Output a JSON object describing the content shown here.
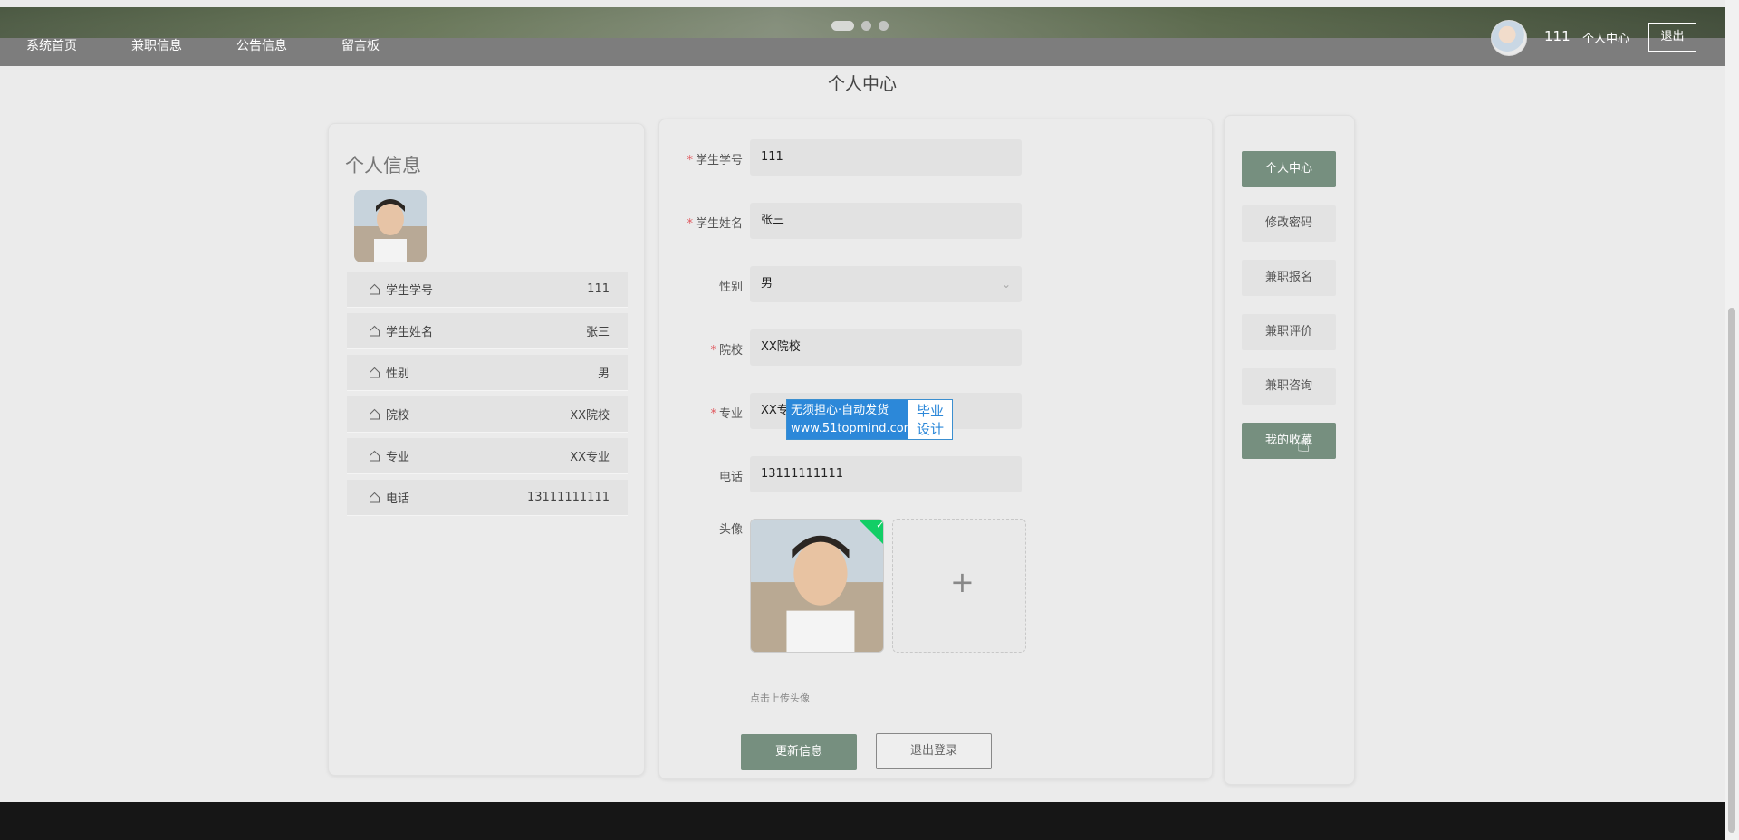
{
  "nav": {
    "items": [
      "系统首页",
      "兼职信息",
      "公告信息",
      "留言板"
    ],
    "username": "111",
    "center_label": "个人中心",
    "logout_label": "退出"
  },
  "page_title": "个人中心",
  "profile": {
    "title": "个人信息",
    "rows": [
      {
        "label": "学生学号",
        "value": "111"
      },
      {
        "label": "学生姓名",
        "value": "张三"
      },
      {
        "label": "性别",
        "value": "男"
      },
      {
        "label": "院校",
        "value": "XX院校"
      },
      {
        "label": "专业",
        "value": "XX专业"
      },
      {
        "label": "电话",
        "value": "13111111111"
      }
    ]
  },
  "form": {
    "student_id_label": "学生学号",
    "student_id_value": "111",
    "name_label": "学生姓名",
    "name_value": "张三",
    "gender_label": "性别",
    "gender_value": "男",
    "school_label": "院校",
    "school_value": "XX院校",
    "major_label": "专业",
    "major_value": "XX专",
    "phone_label": "电话",
    "phone_value": "13111111111",
    "avatar_label": "头像",
    "upload_tip": "点击上传头像",
    "update_button": "更新信息",
    "logout_button": "退出登录"
  },
  "watermark": {
    "line1": "无须担心·自动发货",
    "line2": "www.51topmind.com",
    "right1": "毕业",
    "right2": "设计"
  },
  "side_menu": {
    "items": [
      "个人中心",
      "修改密码",
      "兼职报名",
      "兼职评价",
      "兼职咨询",
      "我的收藏"
    ],
    "active_index": 0,
    "hover_index": 5
  },
  "colors": {
    "accent": "#768f7f",
    "required": "#e0565c",
    "upload_success": "#13ce66"
  }
}
